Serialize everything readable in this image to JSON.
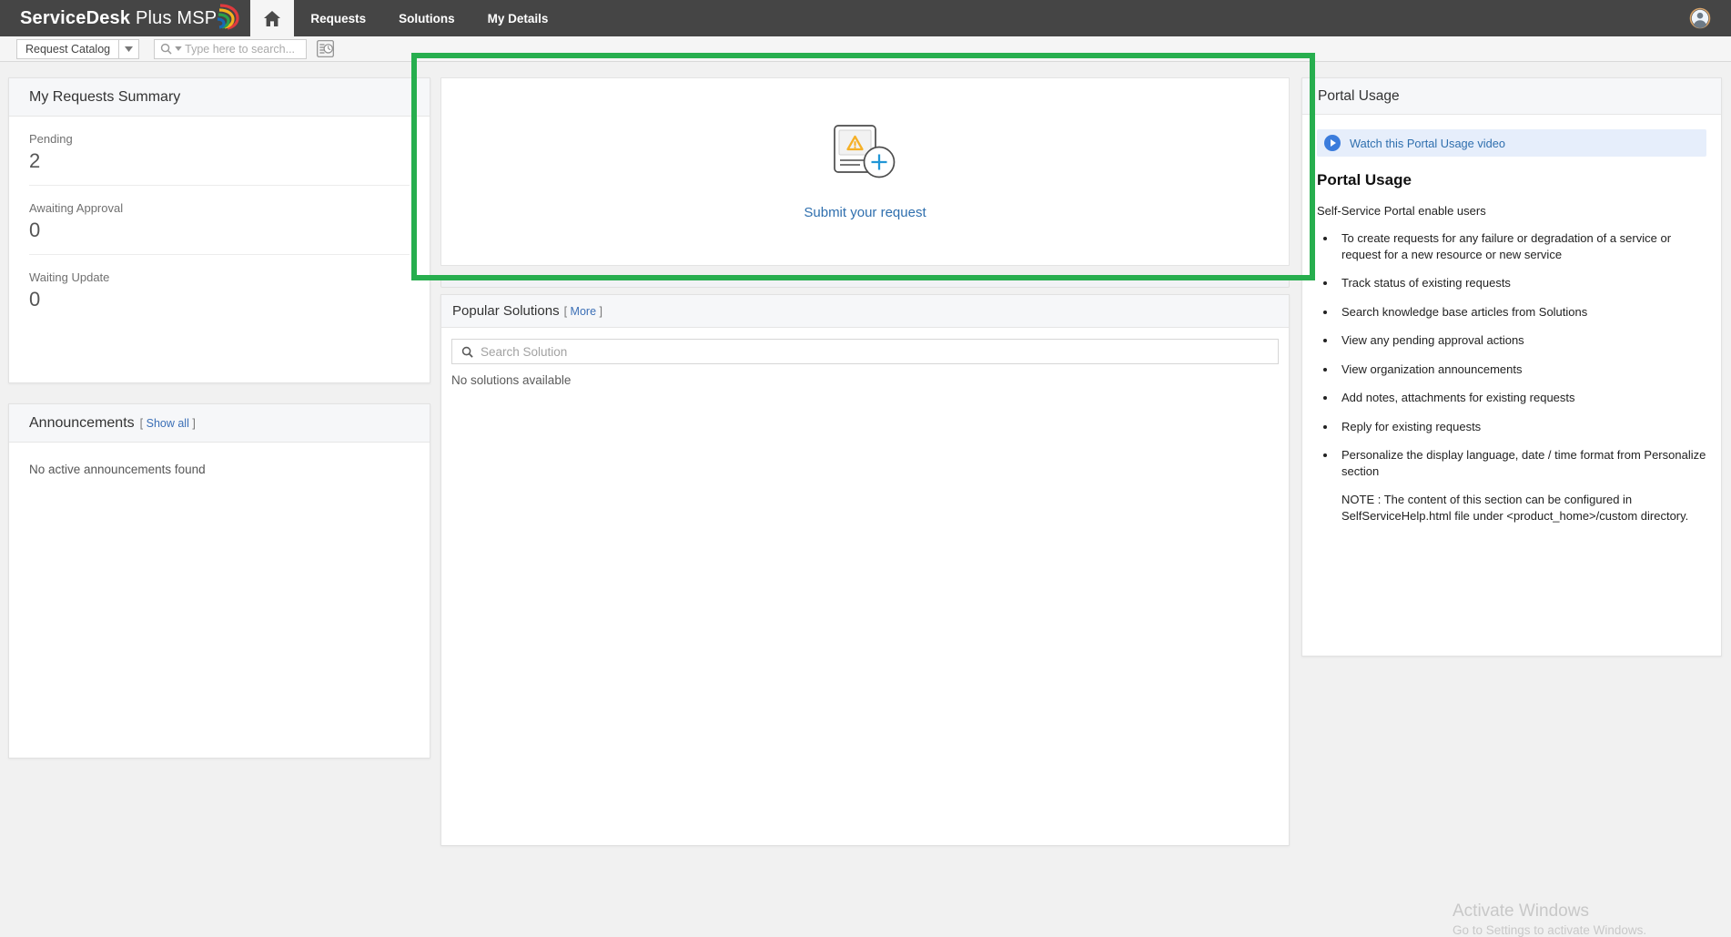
{
  "topnav": {
    "brand_bold": "ServiceDesk",
    "brand_light": " Plus MSP",
    "home_icon": "home-icon",
    "tabs": [
      {
        "label": "Requests"
      },
      {
        "label": "Solutions"
      },
      {
        "label": "My Details"
      }
    ],
    "avatar_icon": "user-avatar-icon"
  },
  "toolbar": {
    "catalog_label": "Request Catalog",
    "catalog_arrow_icon": "chevron-down-icon",
    "search_icon": "search-icon",
    "search_value": "",
    "search_placeholder": "Type here to search...",
    "history_icon": "request-history-icon"
  },
  "left": {
    "summary": {
      "title": "My Requests Summary",
      "rows": [
        {
          "label": "Pending",
          "value": "2"
        },
        {
          "label": "Awaiting Approval",
          "value": "0"
        },
        {
          "label": "Waiting Update",
          "value": "0"
        }
      ]
    },
    "announcements": {
      "title": "Announcements",
      "show_all_open": "[",
      "show_all": "Show all",
      "show_all_close": "]",
      "empty": "No active announcements found"
    }
  },
  "center": {
    "submit": {
      "icon": "new-request-icon",
      "label": "Submit your request"
    },
    "solutions": {
      "title": "Popular Solutions",
      "more_open": "[",
      "more": "More",
      "more_close": "]",
      "search_icon": "search-icon",
      "search_value": "",
      "search_placeholder": "Search Solution",
      "empty": "No solutions available"
    }
  },
  "right": {
    "panel_title": "Portal Usage",
    "video_icon": "play-icon",
    "video_link": "Watch this Portal Usage video",
    "heading": "Portal Usage",
    "subheading": "Self-Service Portal enable users",
    "bullets": [
      "To create requests for any failure or degradation of a service or request for a new resource or new service",
      "Track status of existing requests",
      "Search knowledge base articles from Solutions",
      "View any pending approval actions",
      "View organization announcements",
      "Add notes, attachments for existing requests",
      "Reply for existing requests",
      "Personalize the display language, date / time format from Personalize section"
    ],
    "note": "NOTE : The content of this section can be configured in SelfServiceHelp.html file under <product_home>/custom directory."
  },
  "highlight": {
    "color": "#27ae4e"
  },
  "watermark": {
    "title": "Activate Windows",
    "subtitle": "Go to Settings to activate Windows."
  }
}
